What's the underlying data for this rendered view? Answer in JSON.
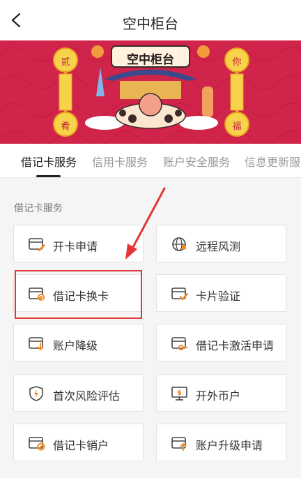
{
  "header": {
    "title": "空中柜台",
    "back_icon": "chevron-left-icon"
  },
  "banner": {
    "title": "空中柜台",
    "left_couplet_top": "贰",
    "left_couplet_bottom": "肴",
    "right_couplet_top": "你",
    "right_couplet_bottom": "福",
    "background_color": "#d0244a"
  },
  "tabs": [
    {
      "label": "借记卡服务",
      "active": true
    },
    {
      "label": "信用卡服务",
      "active": false
    },
    {
      "label": "账户安全服务",
      "active": false
    },
    {
      "label": "信息更新服务",
      "active": false
    }
  ],
  "section": {
    "label": "借记卡服务"
  },
  "services": [
    {
      "label": "开卡申请",
      "icon": "card-edit-icon"
    },
    {
      "label": "远程风测",
      "icon": "globe-shield-icon"
    },
    {
      "label": "借记卡换卡",
      "icon": "card-refresh-icon"
    },
    {
      "label": "卡片验证",
      "icon": "card-check-icon"
    },
    {
      "label": "账户降级",
      "icon": "card-down-icon"
    },
    {
      "label": "借记卡激活申请",
      "icon": "card-key-icon"
    },
    {
      "label": "首次风险评估",
      "icon": "shield-bolt-icon"
    },
    {
      "label": "开外币户",
      "icon": "monitor-dollar-icon"
    },
    {
      "label": "借记卡销户",
      "icon": "card-cancel-icon"
    },
    {
      "label": "账户升级申请",
      "icon": "card-up-icon"
    }
  ],
  "colors": {
    "accent": "#f08a24",
    "annotation": "#e33737"
  }
}
